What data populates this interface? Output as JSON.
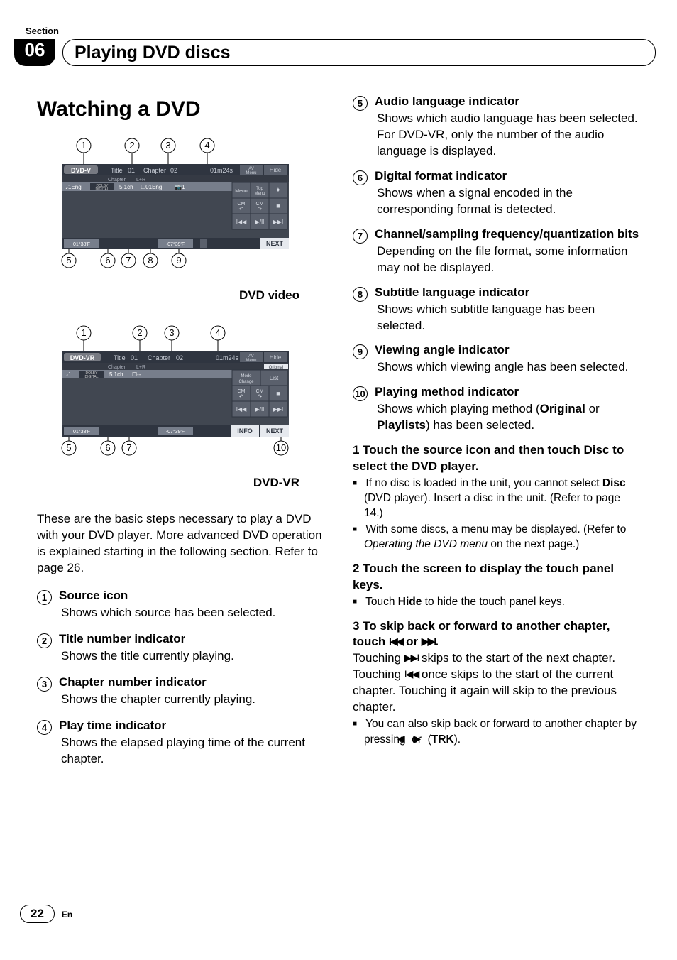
{
  "meta": {
    "section_label": "Section",
    "section_number": "06",
    "section_title": "Playing DVD discs",
    "page_number": "22",
    "lang": "En"
  },
  "left": {
    "heading": "Watching a DVD",
    "caption1": "DVD video",
    "caption2": "DVD-VR",
    "intro": "These are the basic steps necessary to play a DVD with your DVD player. More advanced DVD operation is explained starting in the following section. Refer to page 26.",
    "items": {
      "i1_h": "Source icon",
      "i1_b": "Shows which source has been selected.",
      "i2_h": "Title number indicator",
      "i2_b": "Shows the title currently playing.",
      "i3_h": "Chapter number indicator",
      "i3_b": "Shows the chapter currently playing.",
      "i4_h": "Play time indicator",
      "i4_b": "Shows the elapsed playing time of the current chapter."
    },
    "fig1": {
      "callouts_top": [
        "1",
        "2",
        "3",
        "4"
      ],
      "callouts_bottom": [
        "5",
        "6",
        "7",
        "8",
        "9"
      ],
      "labels": {
        "src": "DVD-V",
        "title": "Title",
        "title_no": "01",
        "chapter": "Chapter",
        "chapter_no": "02",
        "time": "01m24s",
        "av": "AV\nMenu",
        "hide": "Hide",
        "row2_chapter": "Chapter",
        "row2_lr": "L+R",
        "audio": "1Eng",
        "dolby": "DOLBY\nDIGITAL",
        "samp": "5.1ch",
        "sub": "01Eng",
        "angle": "1",
        "menu": "Menu",
        "top": "Top\nMenu",
        "arrows": "↕",
        "cm_back": "CM\n↶",
        "cm_fwd": "CM\n↷",
        "stop": "■",
        "prev": "I◀◀",
        "play": "▶/II",
        "next": "▶▶I",
        "footer_l": "01°38'F",
        "clock": "-07°39'F",
        "next_btn": "NEXT"
      }
    },
    "fig2": {
      "callouts_top": [
        "1",
        "2",
        "3",
        "4"
      ],
      "callouts_bottom": [
        "5",
        "6",
        "7",
        "10"
      ],
      "labels": {
        "src": "DVD-VR",
        "title": "Title",
        "title_no": "01",
        "chapter": "Chapter",
        "chapter_no": "02",
        "time": "01m24s",
        "av": "AV\nMenu",
        "hide": "Hide",
        "row2_chapter": "Chapter",
        "row2_lr": "L+R",
        "orig": "Original",
        "audio": "♪1",
        "dolby": "DOLBY\nDIGITAL",
        "samp": "5.1ch",
        "sub": "--",
        "mode": "Mode\nChange",
        "list": "List",
        "cm_back": "CM\n↶",
        "cm_fwd": "CM\n↷",
        "stop": "■",
        "prev": "I◀◀",
        "play": "▶/II",
        "next": "▶▶I",
        "footer_l": "01°38'F",
        "clock": "-07°39'F",
        "info": "INFO",
        "next_btn": "NEXT"
      }
    }
  },
  "right": {
    "items": {
      "i5_h": "Audio language indicator",
      "i5_b": "Shows which audio language has been selected.\nFor DVD-VR, only the number of the audio language is displayed.",
      "i6_h": "Digital format indicator",
      "i6_b": "Shows when a signal encoded in the corresponding format is detected.",
      "i7_h": "Channel/sampling frequency/quantization bits",
      "i7_b": "Depending on the file format, some information may not be displayed.",
      "i8_h": "Subtitle language indicator",
      "i8_b": "Shows which subtitle language has been selected.",
      "i9_h": "Viewing angle indicator",
      "i9_b": "Shows which viewing angle has been selected.",
      "i10_h": "Playing method indicator",
      "i10_b_pre": "Shows which playing method (",
      "i10_b_b1": "Original",
      "i10_b_mid": " or ",
      "i10_b_b2": "Playlists",
      "i10_b_post": ") has been selected."
    },
    "steps": {
      "s1_h": "1    Touch the source icon and then touch Disc to select the DVD player.",
      "s1_b1a": "If no disc is loaded in the unit, you cannot select ",
      "s1_b1b": "Disc",
      "s1_b1c": " (DVD player). Insert a disc in the unit. (Refer to page 14.)",
      "s1_b2a": "With some discs, a menu may be displayed. (Refer to ",
      "s1_b2i": "Operating the DVD menu",
      "s1_b2b": " on the next page.)",
      "s2_h": "2    Touch the screen to display the touch panel keys.",
      "s2_b1a": "Touch ",
      "s2_b1b": "Hide",
      "s2_b1c": " to hide the touch panel keys.",
      "s3_h_pre": "3    To skip back or forward to another chapter, touch ",
      "s3_h_mid": " or ",
      "s3_h_post": ".",
      "s3_p_a": "Touching ",
      "s3_p_b": " skips to the start of the next chapter. Touching ",
      "s3_p_c": " once skips to the start of the current chapter. Touching it again will skip to the previous chapter.",
      "s3_b1a": "You can also skip back or forward to another chapter by pressing ",
      "s3_b1_mid": " or ",
      "s3_b1b": " (",
      "s3_b1c": "TRK",
      "s3_b1d": ")."
    }
  }
}
